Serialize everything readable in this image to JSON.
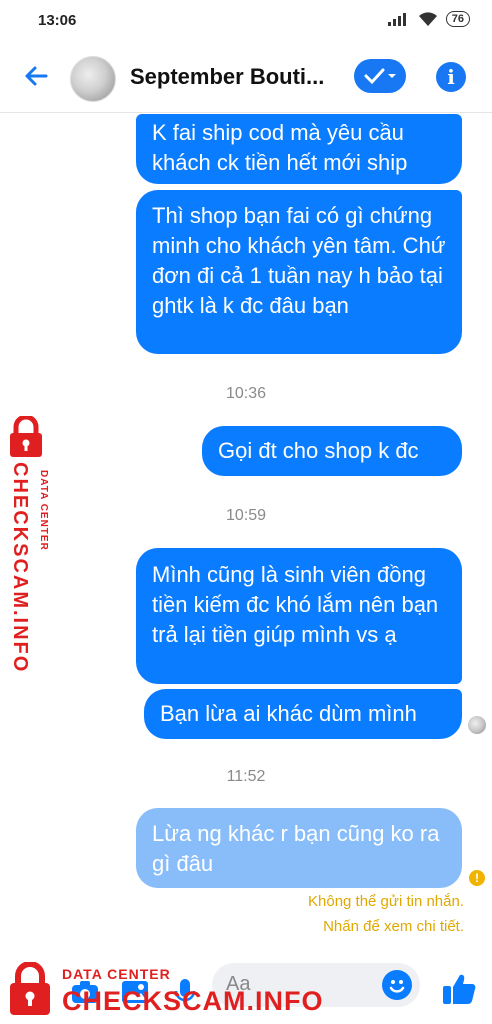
{
  "status_bar": {
    "time": "13:06",
    "battery": "76"
  },
  "header": {
    "title": "September Bouti..."
  },
  "messages": [
    {
      "text": "K fai ship cod mà yêu cầu khách ck tiền hết mới ship"
    },
    {
      "text": "Thì shop bạn fai có gì chứng minh cho khách yên tâm. Chứ đơn đi cả 1 tuần nay h bảo tại ghtk là k đc đâu bạn"
    },
    {
      "text": "Gọi đt cho shop k đc"
    },
    {
      "text": "Mình cũng là sinh viên đồng tiền kiếm đc khó lắm nên bạn trả lại tiền giúp mình vs ạ"
    },
    {
      "text": "Bạn lừa ai khác dùm mình"
    },
    {
      "text": "Lừa ng khác r bạn cũng ko ra gì đâu"
    }
  ],
  "timestamps": [
    "10:36",
    "10:59",
    "11:52"
  ],
  "error": {
    "line1": "Không thể gửi tin nhắn.",
    "line2": "Nhấn để xem chi tiết."
  },
  "composer": {
    "placeholder": "Aa"
  },
  "watermark": {
    "small": "DATA CENTER",
    "big": "CHECKSCAM.INFO"
  },
  "colors": {
    "accent": "#0a7cff",
    "pending": "#88bdf9",
    "warning": "#e0a800",
    "watermark": "#e02020"
  }
}
